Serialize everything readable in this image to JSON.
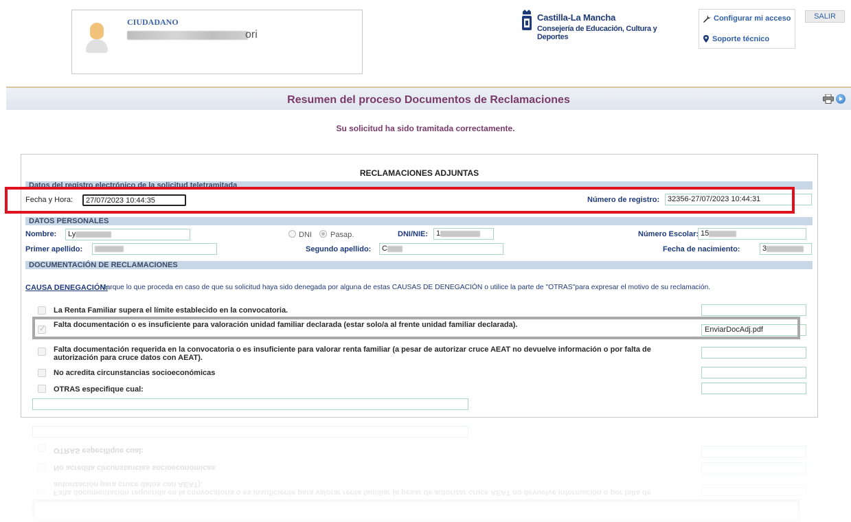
{
  "header": {
    "user_role": "CIUDADANO",
    "user_name_visible": "ori",
    "logo_line1": "Castilla-La Mancha",
    "logo_line2": "Consejería de Educación, Cultura y Deportes",
    "config_link": "Configurar mi acceso",
    "support_link": "Soporte técnico",
    "logout_button": "SALIR",
    "icons": [
      "user-avatar",
      "wrench-icon",
      "pin-icon",
      "print-icon",
      "home-icon"
    ]
  },
  "title_bar": {
    "title": "Resumen del proceso Documentos de Reclamaciones"
  },
  "status_message": "Su solicitud ha sido tramitada correctamente.",
  "panel": {
    "title": "RECLAMACIONES ADJUNTAS",
    "registro": {
      "section": "Datos del registro electrónico de la solicitud teletramitada",
      "fecha_label": "Fecha y Hora:",
      "fecha_value": "27/07/2023 10:44:35",
      "numero_label": "Número de registro:",
      "numero_value": "32356-27/07/2023 10:44:31"
    },
    "personales": {
      "section": "DATOS PERSONALES",
      "nombre_label": "Nombre:",
      "nombre_value": "Ly",
      "dni_label": "DNI",
      "pasap_label": "Pasap.",
      "dninie_label": "DNI/NIE:",
      "dninie_value": "1",
      "numero_escolar_label": "Número Escolar:",
      "numero_escolar_value": "15",
      "primer_apellido_label": "Primer apellido:",
      "segundo_apellido_label": "Segundo apellido:",
      "segundo_apellido_value": "C",
      "fecha_nac_label": "Fecha de nacimiento:",
      "fecha_nac_value": "3"
    },
    "documentacion": {
      "section": "DOCUMENTACIÓN DE RECLAMACIONES",
      "causa_label": "CAUSA DENEGACIÓN:",
      "causa_text": "Marque lo que proceda en caso de que su solicitud haya sido denegada por alguna de estas CAUSAS DE DENEGACIÓN o utilice la parte de \"OTRAS\"para expresar el motivo de su reclamación.",
      "options": [
        {
          "label": "La Renta Familiar supera el límite establecido en la convocatoria.",
          "checked": false,
          "file": ""
        },
        {
          "label": "Falta documentación o es insuficiente para valoración unidad familiar declarada (estar solo/a al frente unidad familiar declarada).",
          "checked": true,
          "file": "EnviarDocAdj.pdf"
        },
        {
          "label": "Falta documentación requerida en la convocatoria o es insuficiente para valorar renta familiar (a pesar de autorizar cruce AEAT no devuelve información o por falta de autorización para cruce datos con AEAT).",
          "checked": false,
          "file": ""
        },
        {
          "label": "No acredita circunstancias socioeconómicas",
          "checked": false,
          "file": ""
        },
        {
          "label": "OTRAS especifique cual:",
          "checked": false,
          "file": ""
        }
      ]
    }
  }
}
